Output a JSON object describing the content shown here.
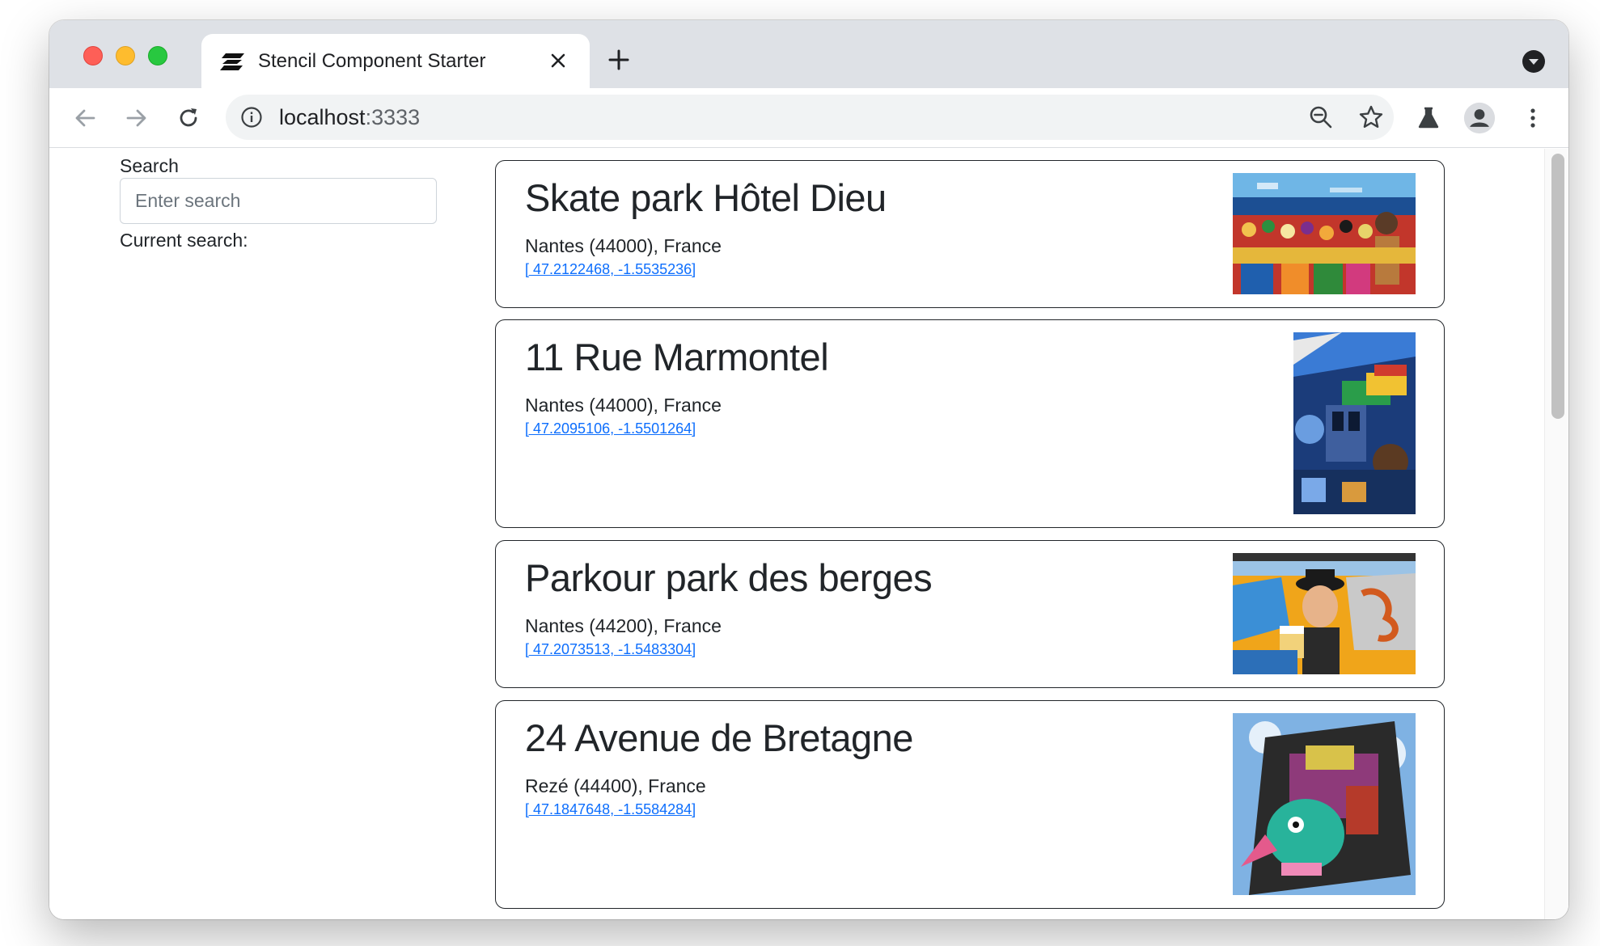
{
  "browser": {
    "tab": {
      "title": "Stencil Component Starter"
    },
    "address": {
      "host": "localhost",
      "port": ":3333"
    }
  },
  "sidebar": {
    "search_label": "Search",
    "search_placeholder": "Enter search",
    "search_value": "",
    "current_search_label": "Current search:"
  },
  "places": [
    {
      "title": "Skate park Hôtel Dieu",
      "city": "Nantes (44000), France",
      "coords": "[ 47.2122468, -1.5535236]",
      "image_alt": "Colorful crowd mural by the water"
    },
    {
      "title": "11 Rue Marmontel",
      "city": "Nantes (44000), France",
      "coords": "[ 47.2095106, -1.5501264]",
      "image_alt": "Blue building-facade mural"
    },
    {
      "title": "Parkour park des berges",
      "city": "Nantes (44200), France",
      "coords": "[ 47.2073513, -1.5483304]",
      "image_alt": "Graffiti wall with man in hat holding a beer"
    },
    {
      "title": "24 Avenue de Bretagne",
      "city": "Rezé (44400), France",
      "coords": "[ 47.1847648, -1.5584284]",
      "image_alt": "Tall wall mural of a green bird creature"
    }
  ],
  "colors": {
    "link": "#0d6efd",
    "text": "#212529",
    "tabstrip": "#dee1e6"
  }
}
